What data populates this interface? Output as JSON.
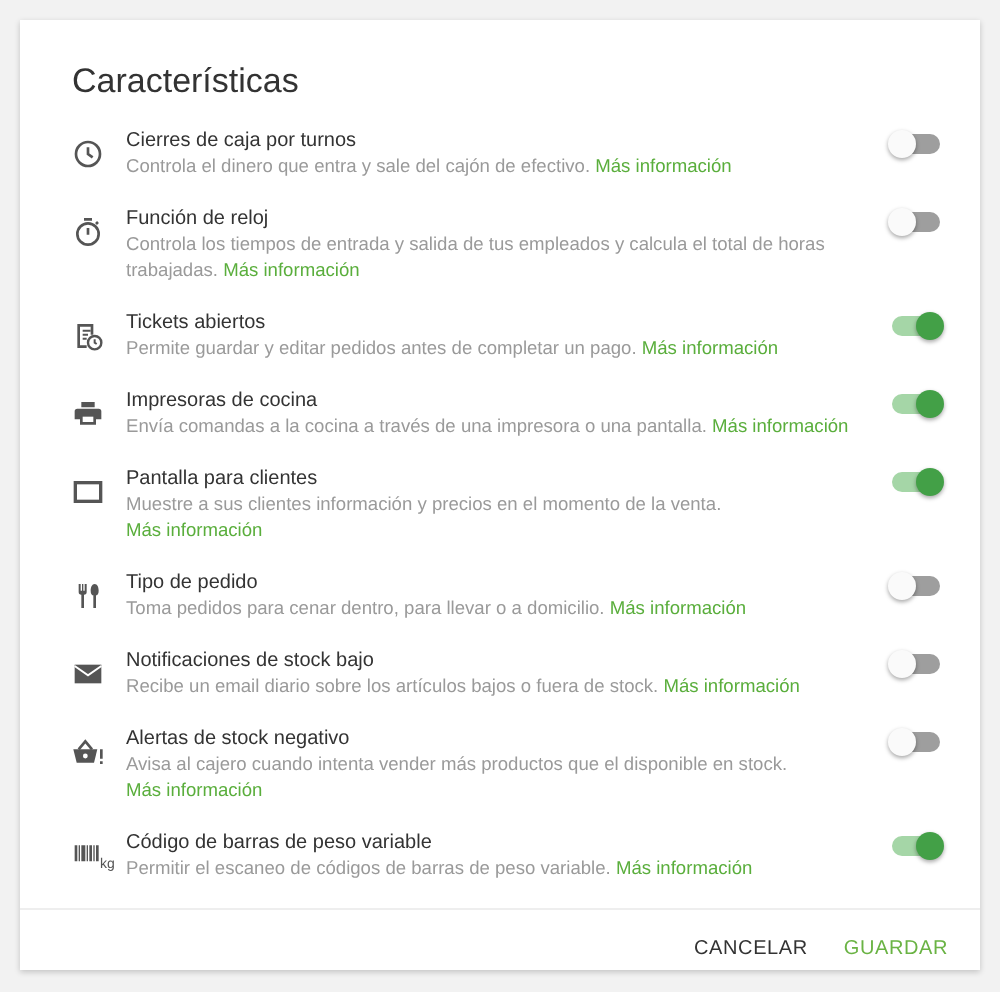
{
  "title": "Características",
  "features": [
    {
      "name": "Cierres de caja por turnos",
      "description": "Controla el dinero que entra y sale del cajón de efectivo.",
      "link": "Más información",
      "on": false
    },
    {
      "name": "Función de reloj",
      "description": "Controla los tiempos de entrada y salida de tus empleados y calcula el total de horas trabajadas.",
      "link": "Más información",
      "on": false
    },
    {
      "name": "Tickets abiertos",
      "description": "Permite guardar y editar pedidos antes de completar un pago.",
      "link": "Más información",
      "on": true
    },
    {
      "name": "Impresoras de cocina",
      "description": "Envía comandas a la cocina a través de una impresora o una pantalla.",
      "link": "Más información",
      "on": true
    },
    {
      "name": "Pantalla para clientes",
      "description": "Muestre a sus clientes información y precios en el momento de la venta.",
      "link": "Más información",
      "on": true
    },
    {
      "name": "Tipo de pedido",
      "description": "Toma pedidos para cenar dentro, para llevar o a domicilio.",
      "link": "Más información",
      "on": false
    },
    {
      "name": "Notificaciones de stock bajo",
      "description": "Recibe un email diario sobre los artículos bajos o fuera de stock.",
      "link": "Más información",
      "on": false
    },
    {
      "name": "Alertas de stock negativo",
      "description": "Avisa al cajero cuando intenta vender más productos que el disponible en stock.",
      "link": "Más información",
      "on": false
    },
    {
      "icon_text": "kg",
      "name": "Código de barras de peso variable",
      "description": "Permitir el escaneo de códigos de barras de peso variable.",
      "link": "Más información",
      "on": true
    }
  ],
  "buttons": [
    {
      "kind": "secondary",
      "label": "CANCELAR"
    },
    {
      "kind": "primary",
      "label": "GUARDAR"
    }
  ]
}
